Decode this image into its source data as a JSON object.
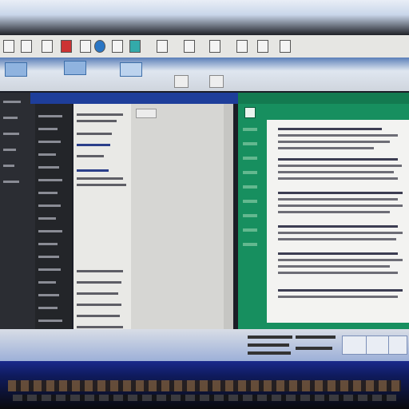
{
  "colors": {
    "bezel": "#e9eef6",
    "toolbar": "#e6e6e3",
    "ribbon_blue": "#5a7fb8",
    "window_title": "#1e3e9a",
    "sidebar_dark": "#2b2d33",
    "list_bg": "#e9e9e6",
    "green_panel": "#178f5f",
    "document": "#f3f3f1",
    "taskbar": "#4a72b9",
    "keyboard": "#1b2a8c"
  },
  "icons": {
    "toolbar": [
      "document-icon",
      "window-icon",
      "folder-icon",
      "chart-icon",
      "app-icon",
      "globe-icon",
      "image-icon",
      "grid-icon",
      "book-icon",
      "mail-icon"
    ],
    "ribbon": [
      "layout-icon",
      "view-icon",
      "sync-icon"
    ],
    "bottom": [
      "tool-icon",
      "globe-icon",
      "chat-icon"
    ]
  }
}
